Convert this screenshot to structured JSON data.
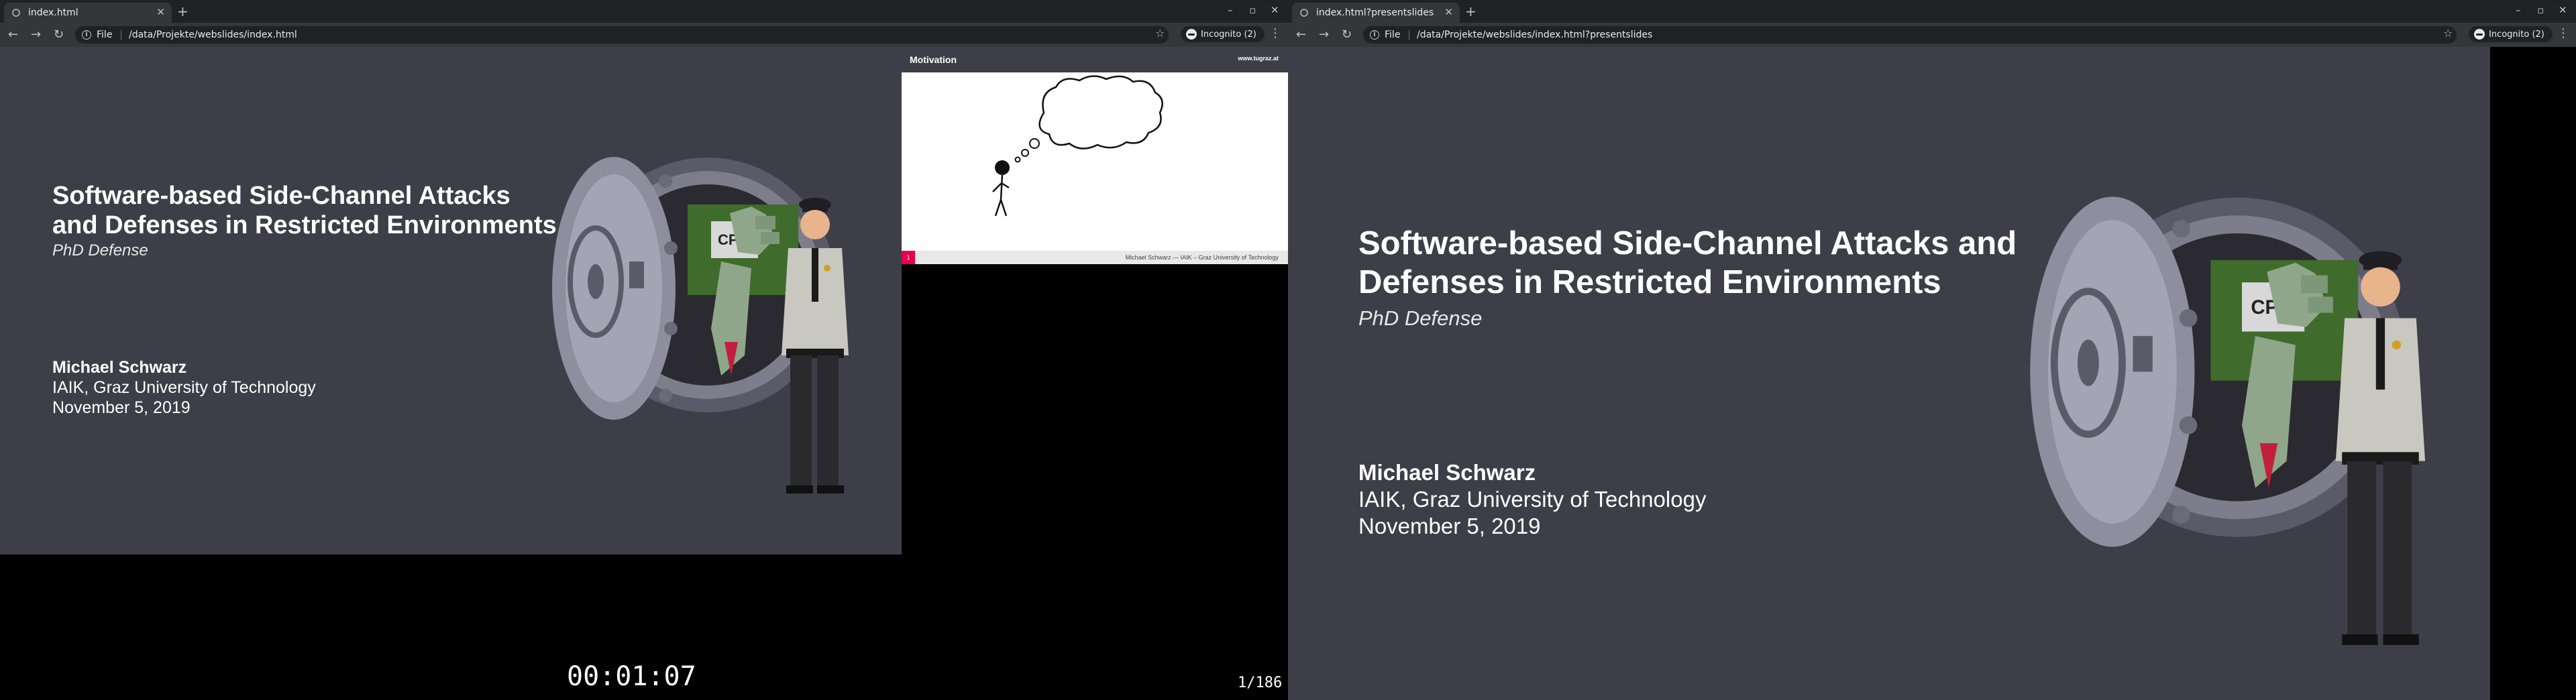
{
  "left_window": {
    "tab_title": "index.html",
    "url_scheme": "File",
    "url_path": "/data/Projekte/webslides/index.html",
    "incognito_label": "Incognito (2)"
  },
  "right_window": {
    "tab_title": "index.html?presentslides",
    "url_scheme": "File",
    "url_path": "/data/Projekte/webslides/index.html?presentslides",
    "incognito_label": "Incognito (2)"
  },
  "slide": {
    "title": "Software-based Side-Channel Attacks and Defenses in Restricted Environments",
    "subtitle": "PhD Defense",
    "author": "Michael Schwarz",
    "affiliation": "IAIK, Graz University of Technology",
    "date": "November 5, 2019",
    "illustration_label": "CPU"
  },
  "next_slide": {
    "title": "Motivation",
    "brand": "www.tugraz.at",
    "page_number": "1",
    "footer": "Michael Schwarz — IAIK – Graz University of Technology"
  },
  "presenter": {
    "timer": "00:01:07",
    "counter": "1/186"
  },
  "colors": {
    "slide_bg": "#3e3e48",
    "browser_dark": "#202124",
    "browser_toolbar": "#35363a",
    "accent": "#e6004c"
  }
}
